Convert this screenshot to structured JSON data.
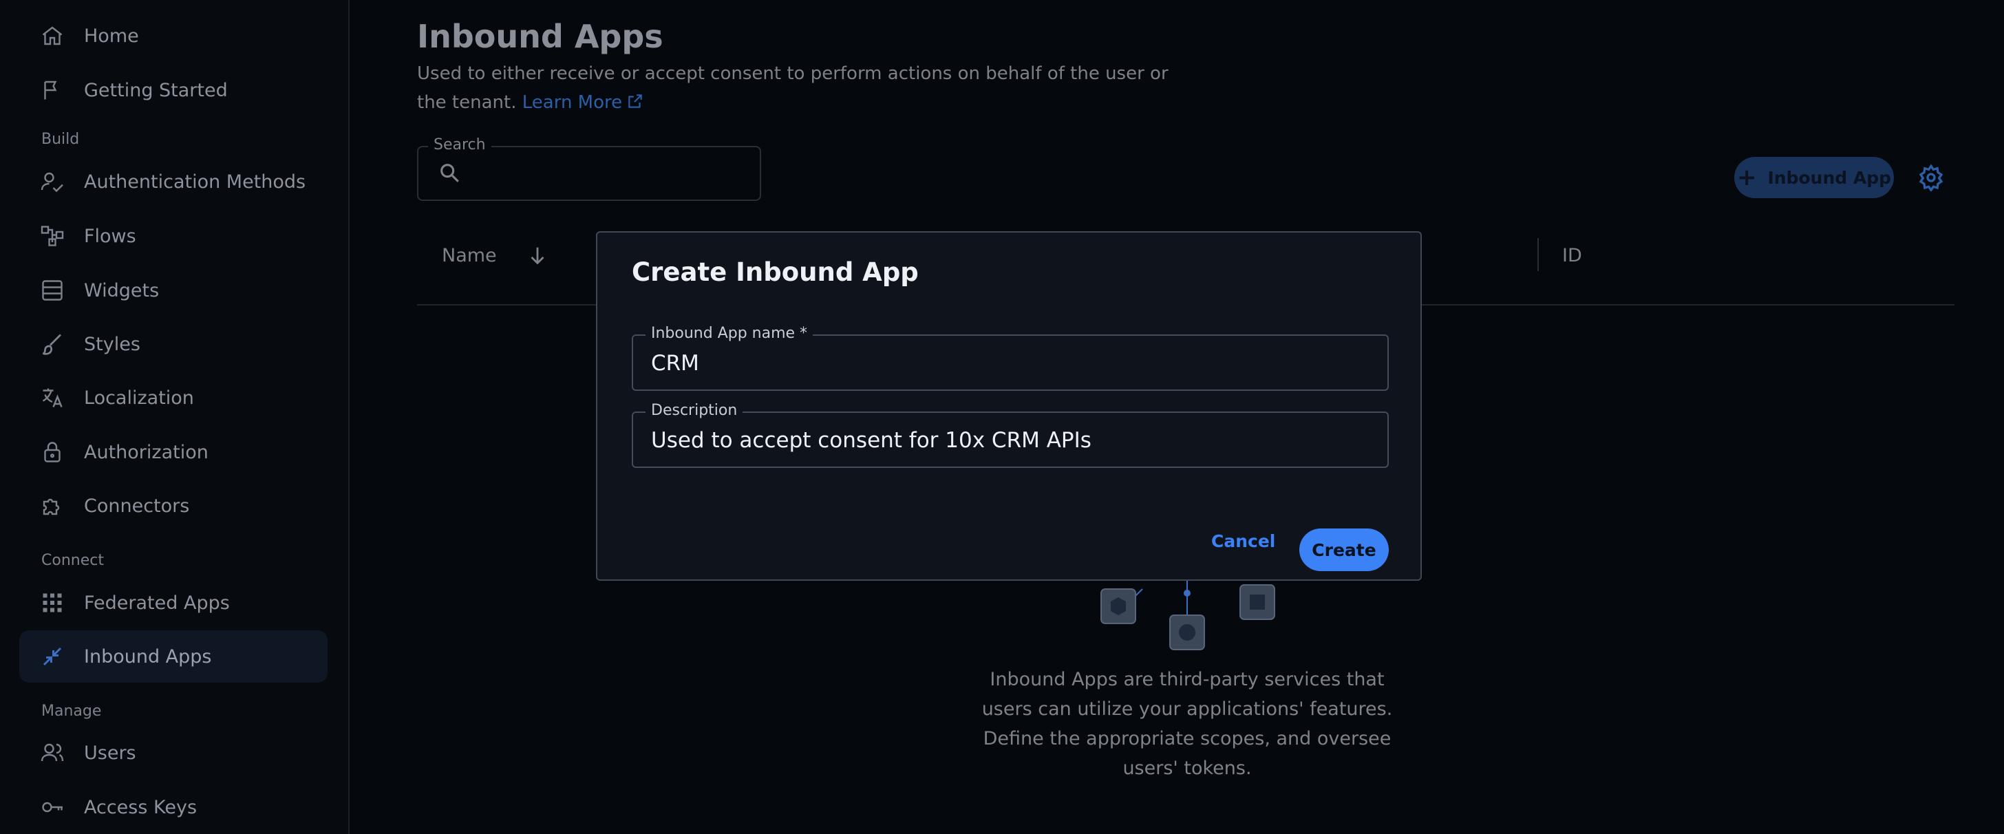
{
  "sidebar": {
    "items": [
      {
        "label": "Home",
        "icon": "home-icon"
      },
      {
        "label": "Getting Started",
        "icon": "flag-icon"
      },
      {
        "label": "Authentication Methods",
        "icon": "user-check-icon"
      },
      {
        "label": "Flows",
        "icon": "flow-icon"
      },
      {
        "label": "Widgets",
        "icon": "widgets-icon"
      },
      {
        "label": "Styles",
        "icon": "brush-icon"
      },
      {
        "label": "Localization",
        "icon": "translate-icon"
      },
      {
        "label": "Authorization",
        "icon": "lock-icon"
      },
      {
        "label": "Connectors",
        "icon": "puzzle-icon"
      },
      {
        "label": "Federated Apps",
        "icon": "grid-icon"
      },
      {
        "label": "Inbound Apps",
        "icon": "inbound-arrows-icon"
      },
      {
        "label": "Users",
        "icon": "users-icon"
      },
      {
        "label": "Access Keys",
        "icon": "key-icon"
      }
    ],
    "sections": {
      "build": "Build",
      "connect": "Connect",
      "manage": "Manage"
    },
    "active_item": "Inbound Apps"
  },
  "main": {
    "title": "Inbound Apps",
    "description": "Used to either receive or accept consent to perform actions on behalf of the user or the tenant.",
    "learn_more": "Learn More",
    "search": {
      "label": "Search",
      "value": ""
    },
    "add_button": "Inbound App",
    "table": {
      "columns": [
        "Name",
        "ID"
      ]
    },
    "empty_state": "Inbound Apps are third-party services that users can utilize your applications' features. Define the appropriate scopes, and oversee users' tokens."
  },
  "modal": {
    "title": "Create Inbound App",
    "name_field": {
      "label": "Inbound App name *",
      "value": "CRM"
    },
    "description_field": {
      "label": "Description",
      "value": "Used to accept consent for 10x CRM APIs"
    },
    "cancel": "Cancel",
    "create": "Create"
  },
  "colors": {
    "accent": "#3b82f6",
    "background": "#05080d",
    "modal_bg": "#0f141c"
  }
}
